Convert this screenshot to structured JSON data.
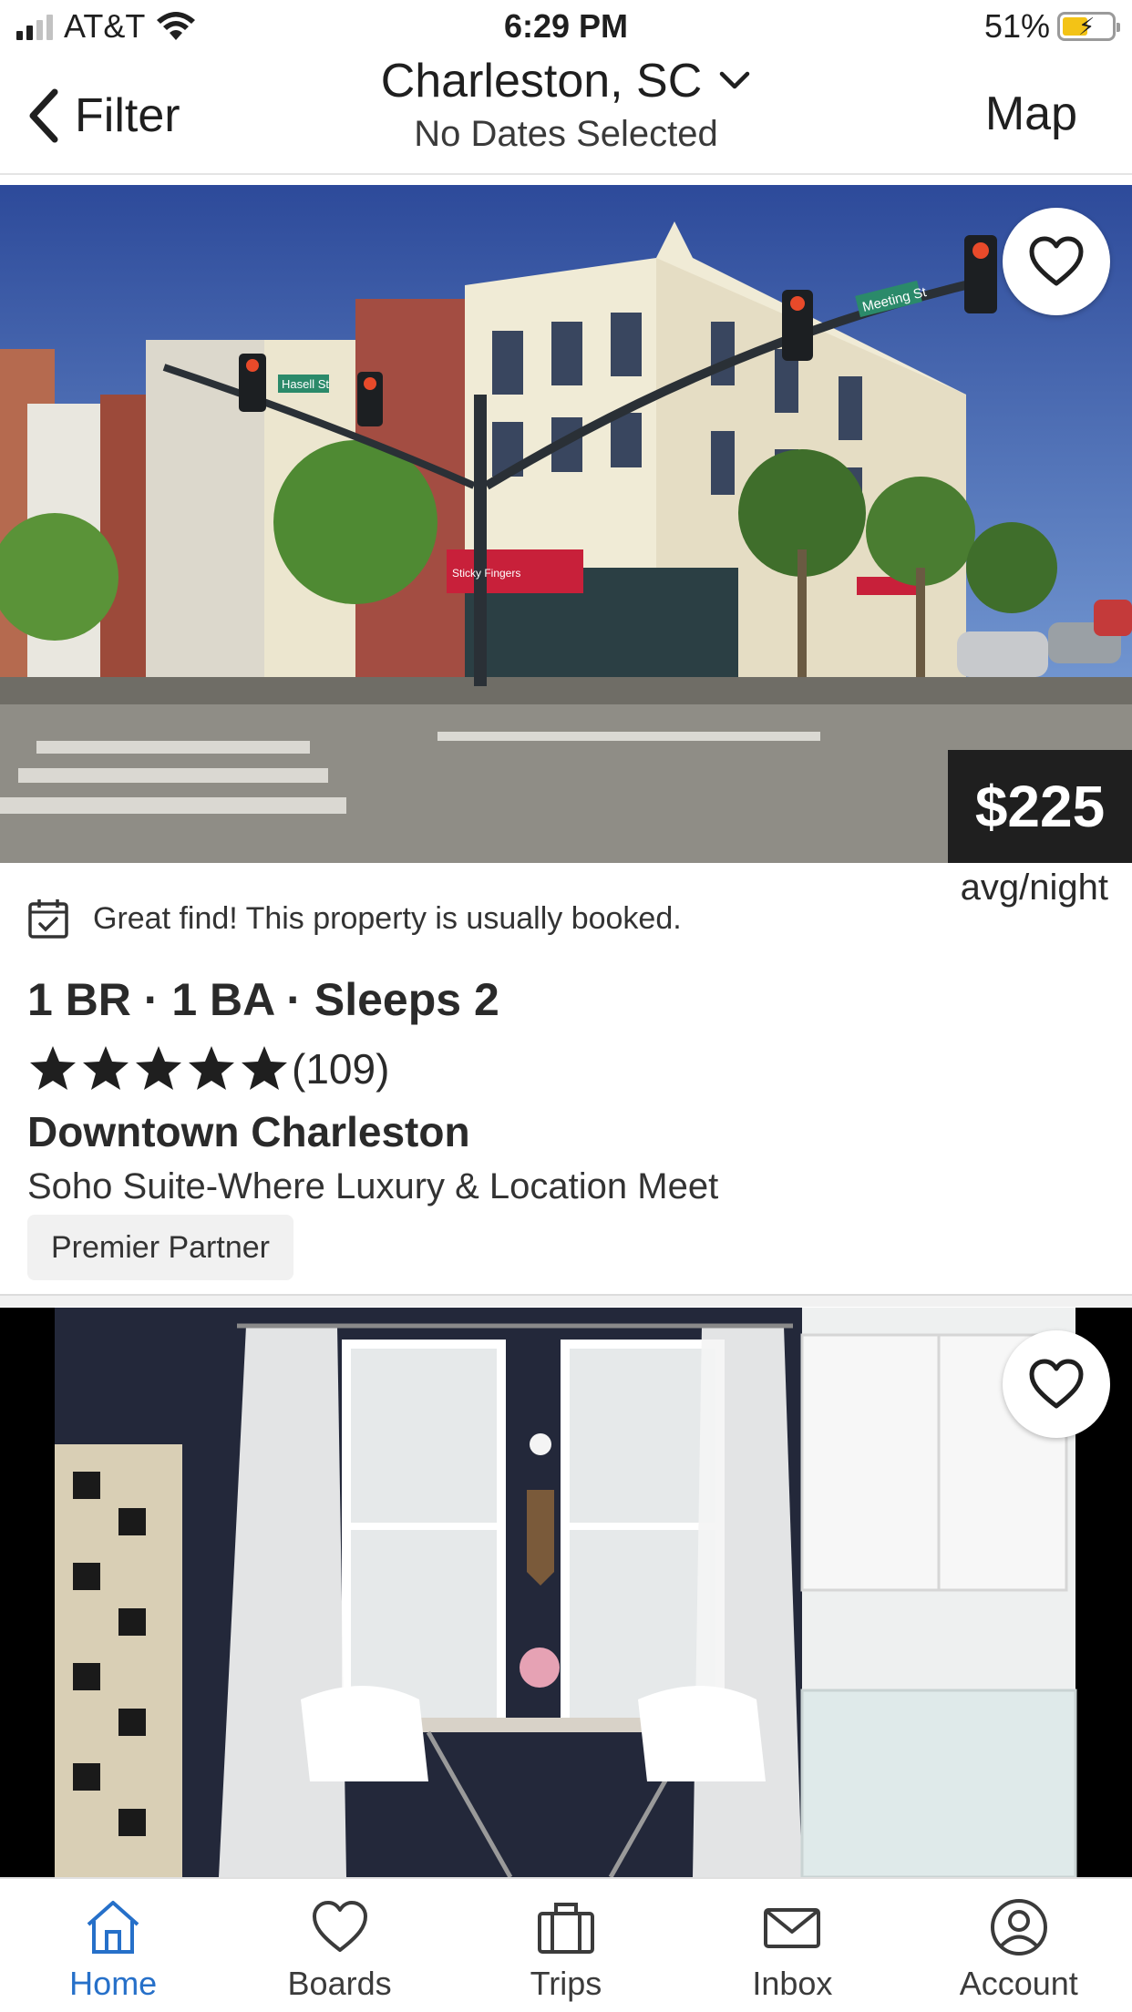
{
  "status_bar": {
    "carrier": "AT&T",
    "time": "6:29 PM",
    "battery_percent": "51%",
    "battery_level": 0.51,
    "signal_bars": 2
  },
  "header": {
    "back_label": "Filter",
    "location": "Charleston, SC",
    "dates": "No Dates Selected",
    "map_label": "Map"
  },
  "listings": [
    {
      "price": "$225",
      "price_unit": "avg/night",
      "notice": "Great find! This property is usually booked.",
      "summary": "1 BR · 1 BA · Sleeps 2",
      "rating": 5,
      "review_count": "(109)",
      "area": "Downtown Charleston",
      "title": "Soho Suite-Where Luxury & Location Meet",
      "badge": "Premier Partner",
      "photo": {
        "street_signs": [
          "Meeting St",
          "Hasell St"
        ],
        "awning_text": "Sticky Fingers"
      }
    }
  ],
  "tabs": [
    {
      "label": "Home",
      "icon": "home-icon",
      "active": true
    },
    {
      "label": "Boards",
      "icon": "heart-icon",
      "active": false
    },
    {
      "label": "Trips",
      "icon": "briefcase-icon",
      "active": false
    },
    {
      "label": "Inbox",
      "icon": "envelope-icon",
      "active": false
    },
    {
      "label": "Account",
      "icon": "user-circle-icon",
      "active": false
    }
  ],
  "colors": {
    "accent": "#2670c9",
    "text": "#1f1f1f",
    "price_bg": "#1f1f1f",
    "badge_bg": "#f1f1f1",
    "battery_fill": "#f3c316"
  }
}
